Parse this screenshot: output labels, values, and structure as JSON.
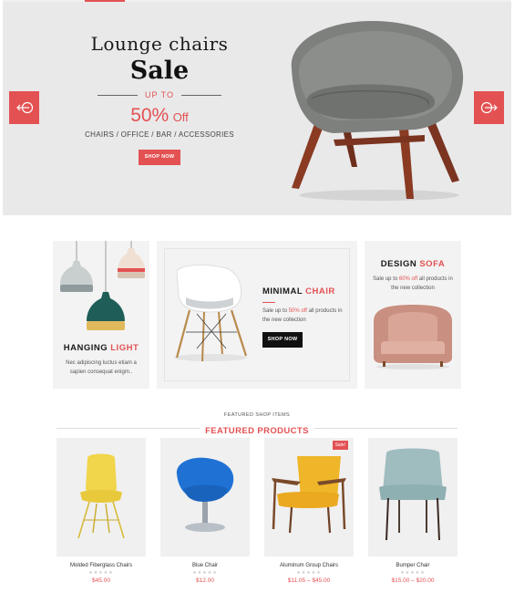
{
  "hero": {
    "title": "Lounge chairs",
    "sale": "Sale",
    "upto": "UP TO",
    "discount_pct": "50%",
    "discount_off": "Off",
    "categories": "CHAIRS / OFFICE / BAR / ACCESSORIES",
    "button": "SHOP NOW"
  },
  "promos": {
    "hanging": {
      "title_main": "HANGING",
      "title_accent": "LIGHT",
      "desc_line1": "Nec adipiscing luctus etiam a",
      "desc_line2": "sapien consequat enigm.."
    },
    "minimal": {
      "title_main": "MINIMAL",
      "title_accent": "CHAIR",
      "desc_pre": "Sale up to",
      "desc_pct": "50% off",
      "desc_post": "all products in",
      "desc_line2": "the new collection",
      "button": "SHOP NOW"
    },
    "design": {
      "title_main": "DESIGN",
      "title_accent": "SOFA",
      "desc_pre": "Sale up to",
      "desc_pct": "60% off",
      "desc_post": "all products in",
      "desc_line2": "the new collection"
    }
  },
  "featured": {
    "small": "FEATURED SHOP ITEMS",
    "title": "FEATURED PRODUCTS",
    "products": [
      {
        "name": "Molded Fiberglass Chairs",
        "price": "$45.00"
      },
      {
        "name": "Blue Chair",
        "price": "$12.00"
      },
      {
        "name": "Aluminum Group Chairs",
        "price": "$11.05 – $45.00",
        "badge": "Sale!"
      },
      {
        "name": "Bumper Chair",
        "price": "$15.00 – $20.00"
      }
    ],
    "stars": "★★★★★"
  },
  "colors": {
    "accent": "#e35152",
    "hero_bg": "#e9e9ea",
    "card_bg": "#f0f0f0"
  },
  "icons": [
    "arrow-left-icon",
    "arrow-right-icon"
  ]
}
